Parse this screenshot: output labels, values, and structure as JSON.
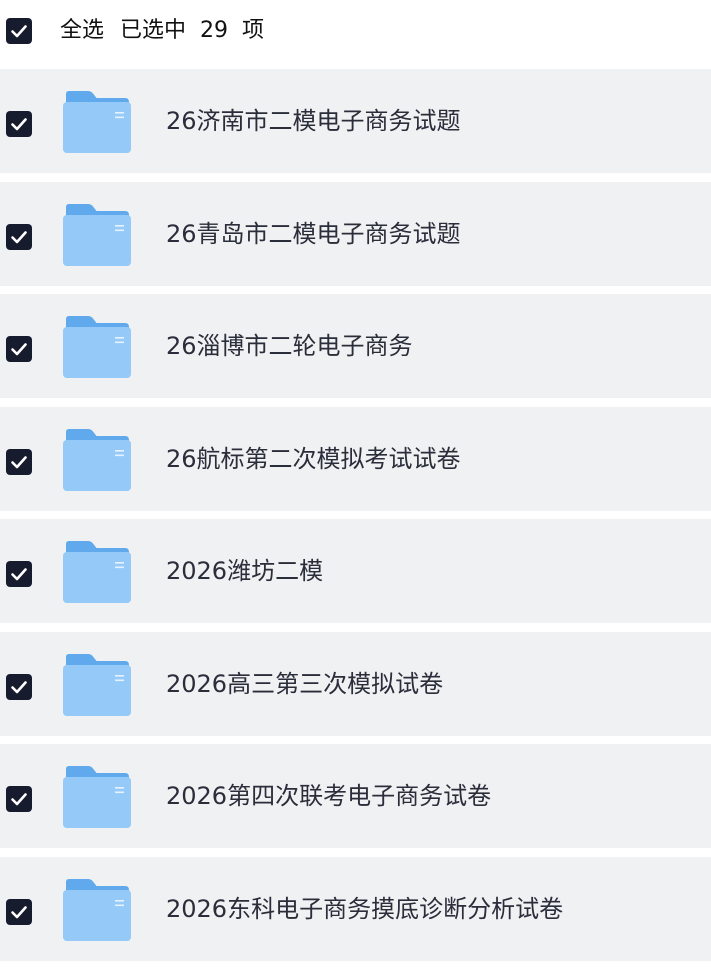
{
  "header": {
    "select_all_label": "全选",
    "selected_prefix": "已选中",
    "selected_count": "29",
    "selected_suffix": "项"
  },
  "items": [
    {
      "name": "26济南市二模电子商务试题",
      "checked": true
    },
    {
      "name": "26青岛市二模电子商务试题",
      "checked": true
    },
    {
      "name": "26淄博市二轮电子商务",
      "checked": true
    },
    {
      "name": "26航标第二次模拟考试试卷",
      "checked": true
    },
    {
      "name": "2026潍坊二模",
      "checked": true
    },
    {
      "name": "2026高三第三次模拟试卷",
      "checked": true
    },
    {
      "name": "2026第四次联考电子商务试卷",
      "checked": true
    },
    {
      "name": "2026东科电子商务摸底诊断分析试卷",
      "checked": true
    }
  ],
  "icons": {
    "checkbox": "checkbox-checked-icon",
    "folder": "folder-icon"
  },
  "colors": {
    "checkbox_fill": "#171b2e",
    "row_background": "#f0f1f3",
    "folder_blue": "#8cc4f5"
  }
}
